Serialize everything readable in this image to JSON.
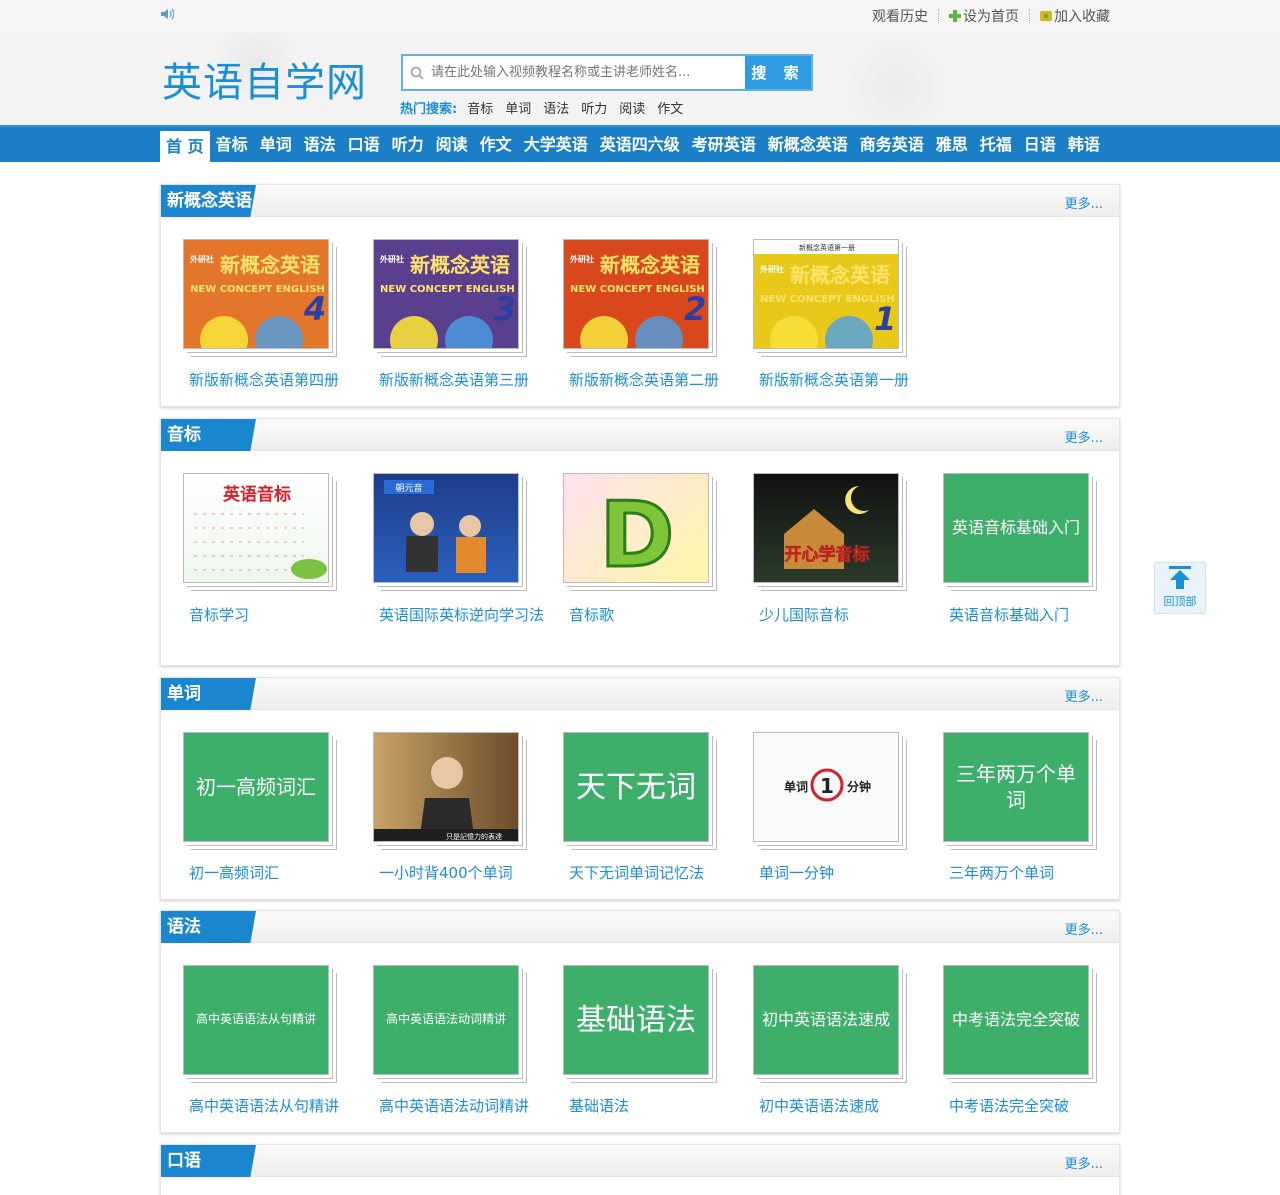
{
  "topbar": {
    "history": "观看历史",
    "set_home": "设为首页",
    "bookmark": "加入收藏"
  },
  "header": {
    "logo": "英语自学网",
    "search_placeholder": "请在此处输入视频教程名称或主讲老师姓名...",
    "search_button": "搜 索",
    "hot_label": "热门搜索:",
    "hot_items": [
      "音标",
      "单词",
      "语法",
      "听力",
      "阅读",
      "作文"
    ]
  },
  "nav": [
    "首 页",
    "音标",
    "单词",
    "语法",
    "口语",
    "听力",
    "阅读",
    "作文",
    "大学英语",
    "英语四六级",
    "考研英语",
    "新概念英语",
    "商务英语",
    "雅思",
    "托福",
    "日语",
    "韩语"
  ],
  "more": "更多...",
  "sections": [
    {
      "title": "新概念英语",
      "items": [
        {
          "label": "新版新概念英语第四册",
          "cover": {
            "brand": "外研社",
            "title": "新概念英语",
            "sub": "NEW CONCEPT ENGLISH",
            "num": "4",
            "color": "#e3762a"
          }
        },
        {
          "label": "新版新概念英语第三册",
          "cover": {
            "brand": "外研社",
            "title": "新概念英语",
            "sub": "NEW CONCEPT ENGLISH",
            "num": "3",
            "color": "#5a3f8f"
          }
        },
        {
          "label": "新版新概念英语第二册",
          "cover": {
            "brand": "外研社",
            "title": "新概念英语",
            "sub": "NEW CONCEPT ENGLISH",
            "num": "2",
            "color": "#d9481c"
          }
        },
        {
          "label": "新版新概念英语第一册",
          "cover": {
            "brand": "外研社",
            "title": "新概念英语",
            "sub": "NEW CONCEPT ENGLISH",
            "num": "1",
            "color": "#e8c91a",
            "top": "新概念英语第一册"
          }
        }
      ]
    },
    {
      "title": "音标",
      "items": [
        {
          "label": "音标学习",
          "cover": {
            "text": "英语音标"
          }
        },
        {
          "label": "英语国际英标逆向学习法",
          "cover": {
            "text": "朝元音"
          }
        },
        {
          "label": "音标歌",
          "cover": {
            "text": "D"
          }
        },
        {
          "label": "少儿国际音标",
          "cover": {
            "text": "开心学音标"
          }
        },
        {
          "label": "英语音标基础入门",
          "cover": {
            "text": "英语音标基础入门"
          }
        }
      ]
    },
    {
      "title": "单词",
      "items": [
        {
          "label": "初一高频词汇",
          "cover": {
            "text": "初一高频词汇"
          }
        },
        {
          "label": "一小时背400个单词",
          "cover": {
            "text": "只是記憶力的表達"
          }
        },
        {
          "label": "天下无词单词记忆法",
          "cover": {
            "text": "天下无词"
          }
        },
        {
          "label": "单词一分钟",
          "cover": {
            "text": "单词 1 分钟"
          }
        },
        {
          "label": "三年两万个单词",
          "cover": {
            "text": "三年两万个单词"
          }
        }
      ]
    },
    {
      "title": "语法",
      "items": [
        {
          "label": "高中英语语法从句精讲",
          "cover": {
            "text": "高中英语语法从句精讲"
          }
        },
        {
          "label": "高中英语语法动词精讲",
          "cover": {
            "text": "高中英语语法动词精讲"
          }
        },
        {
          "label": "基础语法",
          "cover": {
            "text": "基础语法"
          }
        },
        {
          "label": "初中英语语法速成",
          "cover": {
            "text": "初中英语语法速成"
          }
        },
        {
          "label": "中考语法完全突破",
          "cover": {
            "text": "中考语法完全突破"
          }
        }
      ]
    },
    {
      "title": "口语",
      "items": []
    }
  ],
  "totop": "回顶部",
  "colors": {
    "brand_blue": "#1a8fd8",
    "nav_blue": "#1a7fc7",
    "green": "#3daf6b"
  }
}
